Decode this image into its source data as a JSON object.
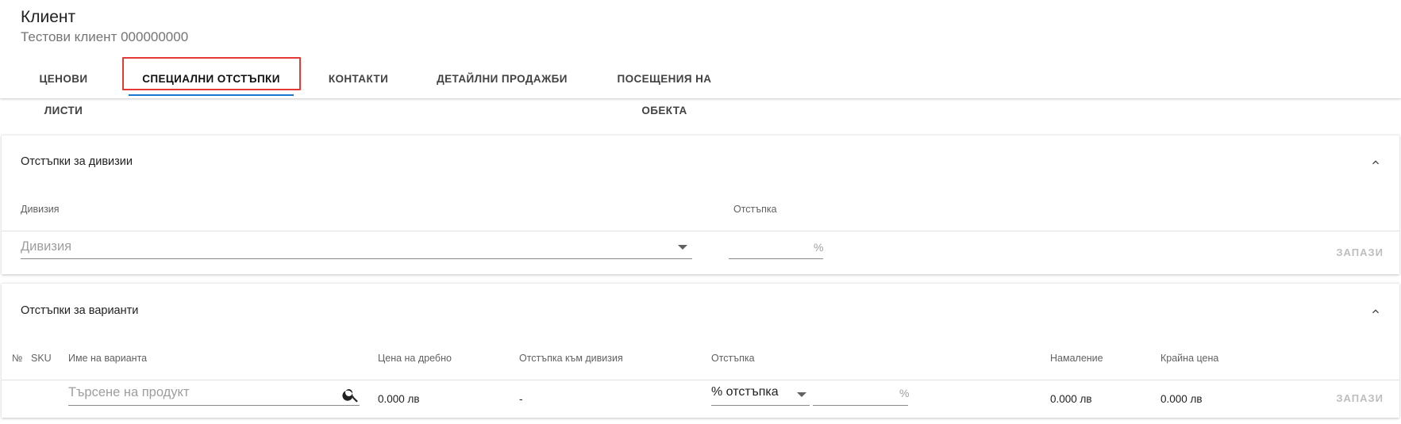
{
  "header": {
    "title": "Клиент",
    "subtitle": "Тестови клиент 000000000"
  },
  "tabs": [
    {
      "label": "ЦЕНОВИ ЛИСТИ",
      "active": false
    },
    {
      "label": "СПЕЦИАЛНИ ОТСТЪПКИ",
      "active": true
    },
    {
      "label": "КОНТАКТИ",
      "active": false
    },
    {
      "label": "ДЕТАЙЛНИ ПРОДАЖБИ",
      "active": false
    },
    {
      "label": "ПОСЕЩЕНИЯ НА ОБЕКТА",
      "active": false
    }
  ],
  "division_panel": {
    "title": "Отстъпки за дивизии",
    "columns": {
      "division": "Дивизия",
      "discount": "Отстъпка"
    },
    "division_select": {
      "placeholder": "Дивизия",
      "value": ""
    },
    "discount_input": {
      "value": "",
      "suffix": "%"
    },
    "save_label": "ЗАПАЗИ"
  },
  "variant_panel": {
    "title": "Отстъпки за варианти",
    "columns": {
      "no": "№",
      "sku": "SKU",
      "name": "Име на варианта",
      "retail_price": "Цена на дребно",
      "division_discount": "Отстъпка към дивизия",
      "discount": "Отстъпка",
      "reduction": "Намаление",
      "final_price": "Крайна цена"
    },
    "row": {
      "search_placeholder": "Търсене на продукт",
      "retail_price": "0.000 лв",
      "division_discount": "-",
      "discount_type": "% отстъпка",
      "discount_value": "",
      "discount_suffix": "%",
      "reduction": "0.000 лв",
      "final_price": "0.000 лв"
    },
    "save_label": "ЗАПАЗИ"
  },
  "colors": {
    "accent": "#1976d2",
    "highlight": "#e53935",
    "disabled": "#bdbdbd"
  },
  "icons": [
    "search-icon",
    "chevron-up-icon",
    "dropdown-arrow-icon"
  ]
}
